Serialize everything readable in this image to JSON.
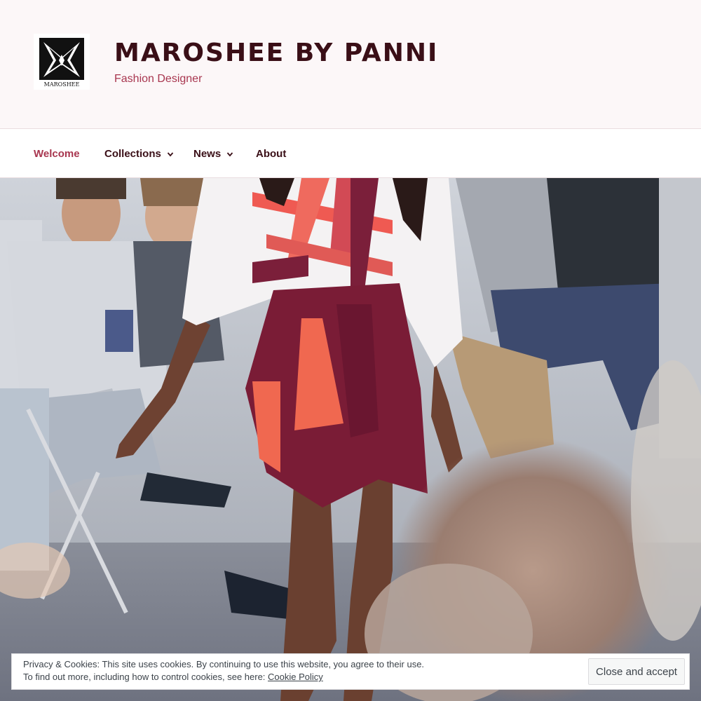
{
  "site": {
    "logo_text": "MAROSHEE",
    "title": "MAROSHEE BY PANNI",
    "description": "Fashion Designer"
  },
  "nav": {
    "items": [
      {
        "label": "Welcome",
        "active": true,
        "has_dropdown": false
      },
      {
        "label": "Collections",
        "active": false,
        "has_dropdown": true
      },
      {
        "label": "News",
        "active": false,
        "has_dropdown": true
      },
      {
        "label": "About",
        "active": false,
        "has_dropdown": false
      }
    ]
  },
  "cookie_notice": {
    "line1": "Privacy & Cookies: This site uses cookies. By continuing to use this website, you agree to their use.",
    "line2_prefix": "To find out more, including how to control cookies, see here: ",
    "link_label": "Cookie Policy",
    "button_label": "Close and accept"
  },
  "colors": {
    "accent": "#a8364f",
    "title": "#3a0f17",
    "header_bg": "#fcf7f8"
  }
}
